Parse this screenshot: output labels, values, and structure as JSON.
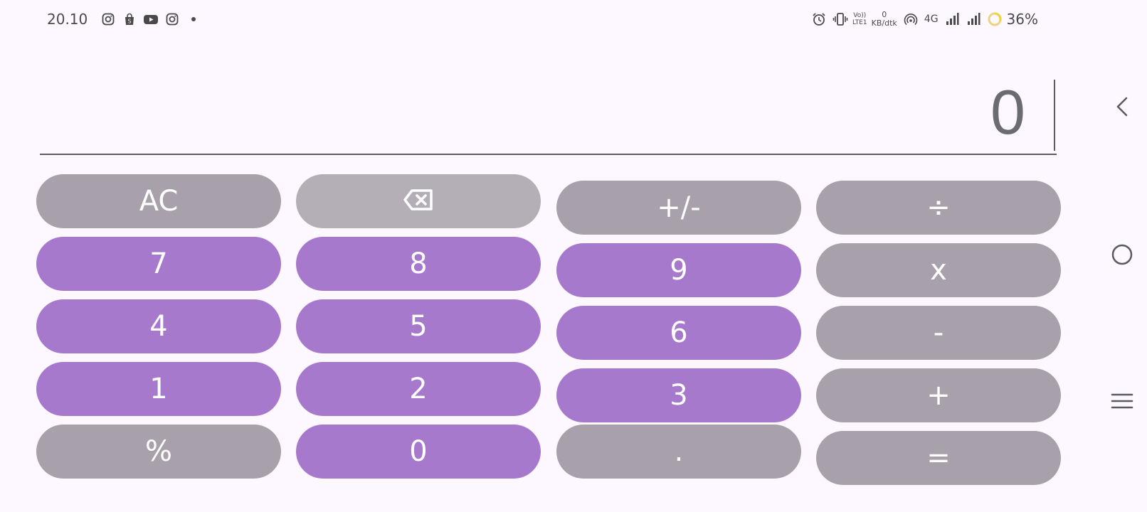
{
  "status_bar": {
    "time": "20.10",
    "left_icons": [
      "instagram-icon",
      "shopping-bag-icon",
      "youtube-icon",
      "instagram-icon",
      "dot-icon"
    ],
    "volte_top": "Vo))",
    "volte_bottom": "LTE1",
    "data_rate_value": "0",
    "data_rate_unit": "KB/dtk",
    "network": "4G",
    "battery": "36%"
  },
  "display": {
    "value": "0"
  },
  "keys": {
    "clear": "AC",
    "backspace_icon": "backspace-icon",
    "sign": "+/-",
    "divide": "÷",
    "seven": "7",
    "eight": "8",
    "nine": "9",
    "multiply": "x",
    "four": "4",
    "five": "5",
    "six": "6",
    "minus": "-",
    "one": "1",
    "two": "2",
    "three": "3",
    "plus": "+",
    "percent": "%",
    "zero": "0",
    "decimal": ".",
    "equals": "="
  },
  "colors": {
    "number_key": "#a679cc",
    "operator_key": "#a8a1ab",
    "background": "#fdf7ff",
    "key_text": "#ffffff"
  },
  "navigation": {
    "icons": [
      "back-icon",
      "home-icon",
      "recents-icon"
    ]
  }
}
